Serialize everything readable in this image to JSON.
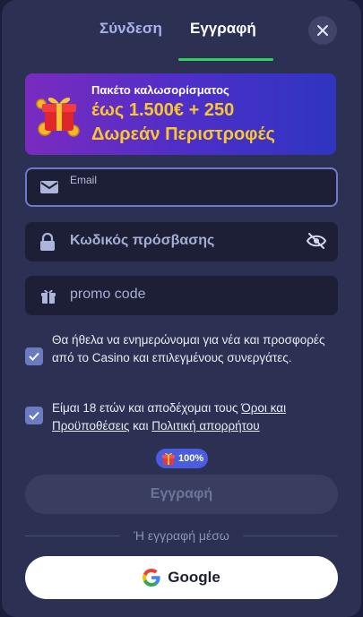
{
  "tabs": {
    "login": "Σύνδεση",
    "register": "Εγγραφή",
    "active": "register"
  },
  "banner": {
    "small": "Πακέτο καλωσορίσματος",
    "big_line1": "έως 1.500€ + 250",
    "big_line2": "Δωρεάν Περιστροφές",
    "icon": "gift-coins-icon"
  },
  "email_field": {
    "label": "Email",
    "value": "",
    "icon": "mail-icon"
  },
  "password_field": {
    "placeholder": "Κωδικός πρόσβασης",
    "icon": "lock-icon",
    "toggle_icon": "eye-slash-icon"
  },
  "promo_field": {
    "placeholder": "promo code",
    "icon": "gift-icon"
  },
  "consents": {
    "news": {
      "checked": true,
      "text": "Θα ήθελα να ενημερώνομαι για νέα και προσφορές από το Casino και επιλεγμένους συνεργάτες."
    },
    "terms": {
      "checked": true,
      "prefix": "Είμαι 18 ετών και αποδέχομαι τους ",
      "terms_link": "Όροι και Προϋποθέσεις",
      "middle": " και ",
      "privacy_link": "Πολιτική απορρήτου"
    }
  },
  "progress_badge": {
    "label": "100%",
    "value": 1.0
  },
  "submit_label": "Εγγραφή",
  "divider_text": "Ή εγγραφή μέσω",
  "google_label": "Google",
  "colors": {
    "accent_green": "#2fd15a",
    "banner_text": "#f8c62d",
    "modal_bg": "#2c3052",
    "field_bg": "#1c1f35"
  }
}
